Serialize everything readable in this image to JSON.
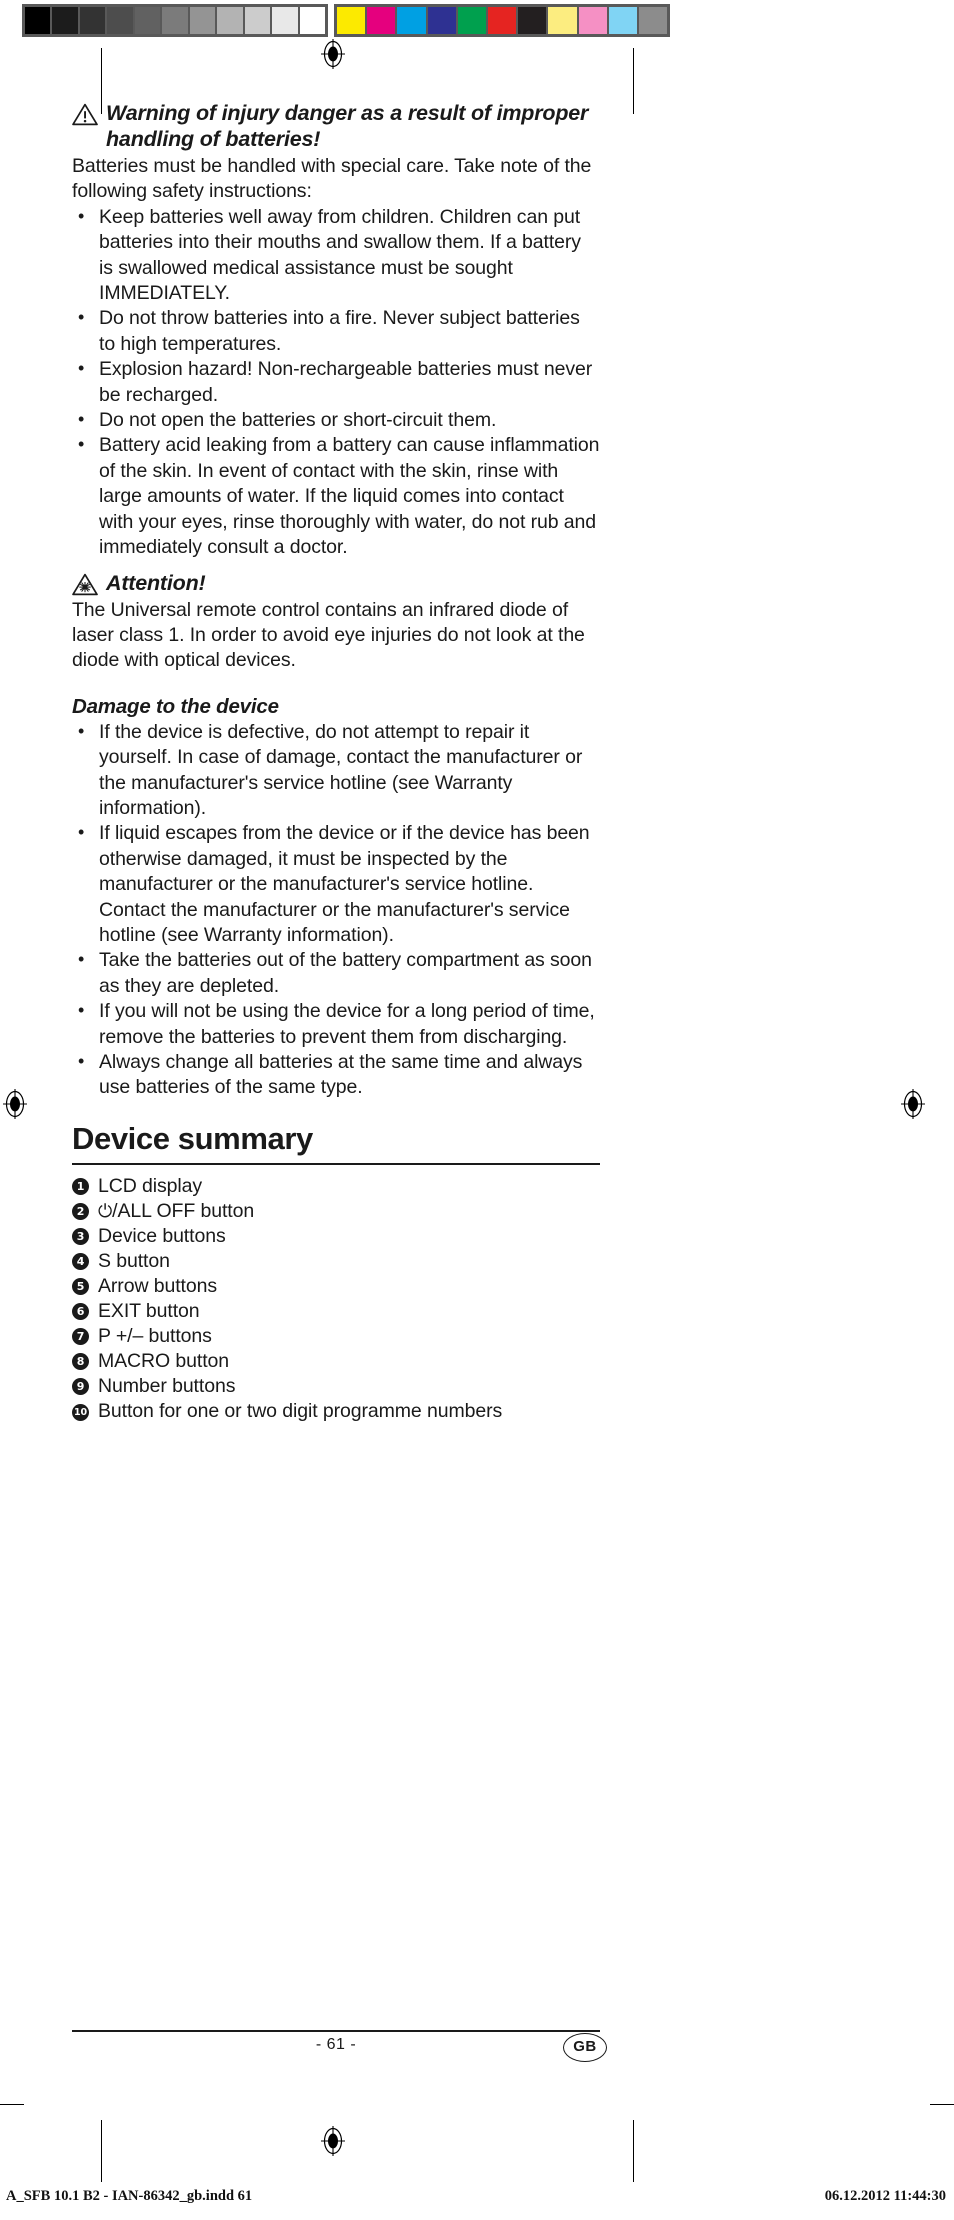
{
  "calibration": {
    "gray_swatches": [
      "#000000",
      "#1c1c1c",
      "#333333",
      "#4d4d4d",
      "#616161",
      "#7b7b7b",
      "#949494",
      "#b3b3b3",
      "#cccccc",
      "#e8e8e8",
      "#ffffff"
    ],
    "color_swatches": [
      "#fcea00",
      "#e5007e",
      "#00a0e3",
      "#2e3192",
      "#00a04e",
      "#e52421",
      "#231f20",
      "#fced80",
      "#f590c4",
      "#80d4f4",
      "#8c8c8c"
    ],
    "bar_frame_color": "#595959"
  },
  "warning_battery": {
    "icon": "warning-triangle-icon",
    "heading": "Warning of injury danger as a result of improper handling of batteries!",
    "intro": "Batteries must be handled with special care. Take note of the following safety instructions:",
    "bullets": [
      "Keep batteries well away from children. Children can put batteries into their mouths and swallow them. If a battery is swallowed medical assistance must be sought IMMEDIATELY.",
      "Do not throw batteries into a fire. Never subject batteries to high temperatures.",
      "Explosion hazard! Non-rechargeable batteries must never be recharged.",
      "Do not open the batteries or short-circuit them.",
      "Battery acid leaking from a battery can cause inflammation of the skin. In event of contact with the skin, rinse with large amounts of water. If the liquid comes into contact with your eyes, rinse thoroughly with water, do not rub and immediately consult a doctor."
    ]
  },
  "attention": {
    "icon": "laser-radiation-triangle-icon",
    "heading": "Attention!",
    "body": "The Universal remote control contains an infrared diode of laser class 1. In order to avoid eye injuries do not look at the diode with optical devices."
  },
  "damage": {
    "heading": "Damage to the device",
    "bullets": [
      "If the device is defective, do not attempt to repair it yourself. In case of damage, contact the manufacturer or the manufacturer's service hotline (see Warranty information).",
      "If liquid escapes from the device or if the device has been otherwise damaged, it must be inspected by the manufacturer or the manufacturer's service hotline. Contact the manufacturer or the manufacturer's service hotline (see Warranty information).",
      "Take the batteries out of the battery compartment as soon as they are depleted.",
      "If you will not be using the device for a long period of time, remove the batteries to prevent them from discharging.",
      "Always change all batteries at the same time and always use batteries of the same type."
    ]
  },
  "device_summary": {
    "title": "Device summary",
    "items": [
      {
        "num": "1",
        "label": "LCD display"
      },
      {
        "num": "2",
        "label": "/ALL OFF button",
        "prefix_icon": "power-symbol"
      },
      {
        "num": "3",
        "label": "Device buttons"
      },
      {
        "num": "4",
        "label": "S button"
      },
      {
        "num": "5",
        "label": "Arrow buttons"
      },
      {
        "num": "6",
        "label": "EXIT button"
      },
      {
        "num": "7",
        "label": "P +/– buttons"
      },
      {
        "num": "8",
        "label": "MACRO button"
      },
      {
        "num": "9",
        "label": "Number buttons"
      },
      {
        "num": "10",
        "label": "Button for one or two digit programme numbers"
      }
    ]
  },
  "footer": {
    "page_number": "- 61 -",
    "locale_badge": "GB",
    "imprint_left": "A_SFB 10.1 B2 - IAN-86342_gb.indd   61",
    "imprint_right": "06.12.2012   11:44:30"
  }
}
